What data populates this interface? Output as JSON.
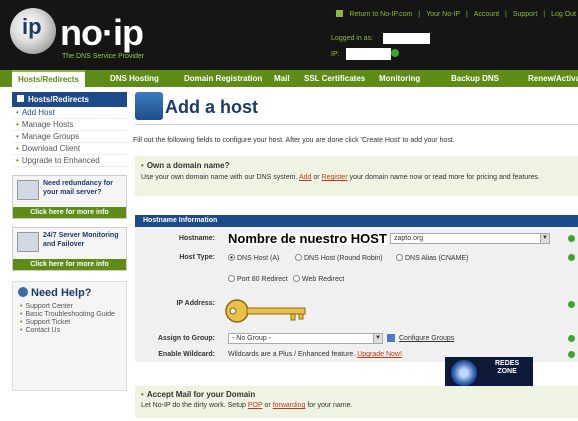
{
  "header": {
    "logo_text": "no·ip",
    "logo_badge": "ip",
    "tagline": "The DNS Service Provider",
    "top_links": {
      "return": "Return to No-IP.com",
      "your_noip": "Your No-IP",
      "account": "Account",
      "support": "Support",
      "logout": "Log Out"
    },
    "logged_in_label": "Logged in as:",
    "ip_label": "IP:"
  },
  "nav": {
    "items": [
      "Hosts/Redirects",
      "DNS Hosting",
      "Domain Registration",
      "Mail",
      "SSL Certificates",
      "Monitoring",
      "Backup DNS",
      "Renew/Activate"
    ]
  },
  "sidebar": {
    "heading": "Hosts/Redirects",
    "items": [
      "Add Host",
      "Manage Hosts",
      "Manage Groups",
      "Download Client",
      "Upgrade to Enhanced"
    ],
    "promo1": {
      "text": "Need redundancy for your mail server?",
      "button": "Click here for more info"
    },
    "promo2": {
      "text": "24/7 Server Monitoring and Failover",
      "button": "Click here for more info"
    },
    "help": {
      "title": "Need Help?",
      "links": [
        "Support Center",
        "Basic Troubleshooting Guide",
        "Support Ticket",
        "Contact Us"
      ]
    }
  },
  "main": {
    "title": "Add a host",
    "intro": "Fill out the following fields to configure your host. After you are done click 'Create Host' to add your host.",
    "own_domain": {
      "title": "Own a domain name?",
      "text_a": "Use your own domain name with our DNS system.",
      "add": "Add",
      "or": "or",
      "register": "Register",
      "text_b": "your domain name now or read more for pricing and features."
    },
    "form": {
      "section": "Hostname Information",
      "hostname_label": "Hostname:",
      "hostname_value": "Nombre de nuestro HOST",
      "domain_value": "zapto.org",
      "host_type_label": "Host Type:",
      "host_types": [
        "DNS Host (A)",
        "DNS Host (Round Robin)",
        "DNS Alias (CNAME)",
        "Port 80 Redirect",
        "Web Redirect"
      ],
      "ip_label": "IP Address:",
      "group_label": "Assign to Group:",
      "group_value": "- No Group -",
      "configure_groups": "Configure Groups",
      "wildcard_label": "Enable Wildcard:",
      "wildcard_text": "Wildcards are a Plus / Enhanced feature.",
      "upgrade": "Upgrade Now!"
    },
    "watermark": {
      "line1": "REDES",
      "line2": "ZONE"
    },
    "mail": {
      "title": "Accept Mail for your Domain",
      "text_a": "Let No-IP do the dirty work. Setup",
      "pop": "POP",
      "or": "or",
      "forwarding": "forwarding",
      "text_b": "for your name."
    }
  }
}
